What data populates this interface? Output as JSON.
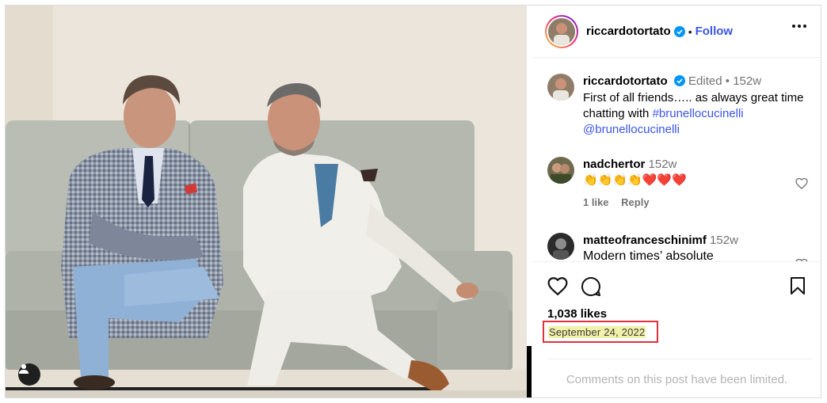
{
  "post": {
    "author": "riccardotortato",
    "follow_label": "Follow",
    "separator": "•",
    "caption": {
      "user": "riccardotortato",
      "edited": "Edited",
      "meta_sep": "•",
      "age": "152w",
      "text_before": "First of all friends….. as always great time chatting with",
      "hashtag": "#brunellocucinelli",
      "mention": "@brunellocucinelli"
    },
    "comments": [
      {
        "user": "nadchertor",
        "age": "152w",
        "text": "👏👏👏👏❤️❤️❤️",
        "likes_label": "1 like",
        "reply_label": "Reply"
      },
      {
        "user": "matteofranceschinimf",
        "age": "152w",
        "text": "Modern times’ absolute"
      }
    ],
    "likes": "1,038 likes",
    "date": "September 24, 2022",
    "limited_notice": "Comments on this post have been limited."
  },
  "colors": {
    "link": "#3b55e6",
    "verified": "#0095f6",
    "highlight": "#f3f0a8",
    "annotation_box": "#e0313c"
  },
  "icons": [
    "verified-badge-icon",
    "more-options-icon",
    "heart-icon",
    "comment-icon",
    "bookmark-icon",
    "user-tag-icon"
  ]
}
